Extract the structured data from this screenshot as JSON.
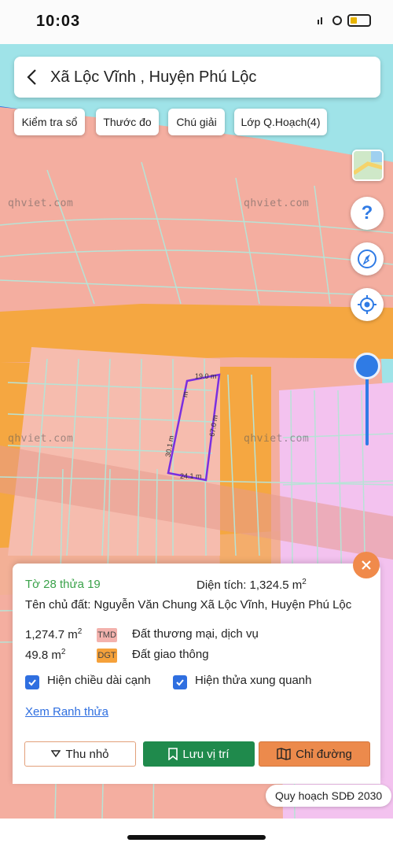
{
  "status": {
    "time": "10:03"
  },
  "header": {
    "title": "Xã Lộc Vĩnh , Huyện Phú Lộc"
  },
  "toolbar": {
    "chips": [
      "Kiểm tra sổ",
      "Thước đo",
      "Chú giải",
      "Lớp Q.Hoạch(4)"
    ]
  },
  "map": {
    "watermark": "qhviet.com",
    "measures": {
      "top": "19.0 m",
      "right": "67.0 m",
      "bottom": "24.1 m",
      "left": "30.1 m",
      "upper_left": "m"
    },
    "colors": {
      "land": "#f4aea0",
      "road": "#f7a63a",
      "sea": "#9fe3e8",
      "commercial": "#f3c2ef",
      "parcel_line": "#7a2fe0",
      "grid_line": "#b7e3d6"
    }
  },
  "panel": {
    "sheet_parcel": "Tờ 28 thửa 19",
    "area_label": "Diện tích: 1,324.5 m",
    "area_unit_power": "2",
    "owner": "Tên chủ đất: Nguyễn Văn Chung Xã Lộc Vĩnh, Huyện Phú Lộc",
    "uses": [
      {
        "area": "1,274.7 m",
        "power": "2",
        "code": "TMD",
        "name": "Đất thương mại, dịch vụ",
        "color": "#f3b2ad"
      },
      {
        "area": "49.8 m",
        "power": "2",
        "code": "DGT",
        "name": "Đất giao thông",
        "color": "#f5a13a"
      }
    ],
    "checkbox_edges": "Hiện chiều dài cạnh",
    "checkbox_neighbors": "Hiện thửa xung quanh",
    "link_boundary": "Xem Ranh thửa",
    "btn_collapse": "Thu nhỏ",
    "btn_save": "Lưu vị trí",
    "btn_directions": "Chỉ đường"
  },
  "plan_label": "Quy hoạch SDĐ 2030",
  "icons": [
    "back-icon",
    "help-icon",
    "compass-icon",
    "locate-icon",
    "close-icon",
    "chevron-down-icon",
    "bookmark-icon",
    "map-icon",
    "check-icon"
  ]
}
